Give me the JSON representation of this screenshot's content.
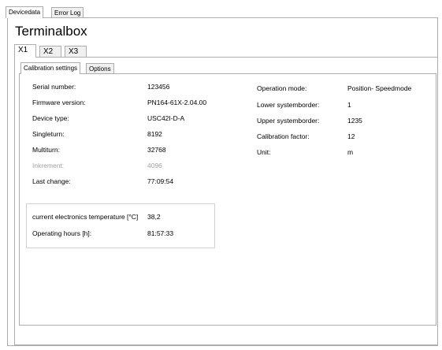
{
  "top_tabs": [
    {
      "label": "Devicedata",
      "active": true
    },
    {
      "label": "Error Log",
      "active": false
    }
  ],
  "page_title": "Terminalbox",
  "terminal_tabs": [
    {
      "label": "X1",
      "active": true
    },
    {
      "label": "X2",
      "active": false
    },
    {
      "label": "X3",
      "active": false
    }
  ],
  "config_tabs": [
    {
      "label": "Calibration settings",
      "active": true
    },
    {
      "label": "Options",
      "active": false
    }
  ],
  "left_fields": [
    {
      "label": "Serial number:",
      "value": "123456",
      "disabled": false
    },
    {
      "label": "Firmware version:",
      "value": "PN164-61X-2.04.00",
      "disabled": false
    },
    {
      "label": "Device type:",
      "value": "USC42I-D-A",
      "disabled": false
    },
    {
      "label": "Singleturn:",
      "value": "8192",
      "disabled": false
    },
    {
      "label": "Multiturn:",
      "value": "32768",
      "disabled": false
    },
    {
      "label": "Inkrement:",
      "value": "4096",
      "disabled": true
    },
    {
      "label": "Last change:",
      "value": "77:09:54",
      "disabled": false
    }
  ],
  "right_fields": [
    {
      "label": "Operation mode:",
      "value": "Position- Speedmode"
    },
    {
      "label": "Lower systemborder:",
      "value": "1"
    },
    {
      "label": "Upper systemborder:",
      "value": "1235"
    },
    {
      "label": "Calibration factor:",
      "value": "12"
    },
    {
      "label": "Unit:",
      "value": "m"
    }
  ],
  "status_group": [
    {
      "label": "current electronics temperature [°C]",
      "value": "38,2"
    },
    {
      "label": "Operating hours [h]:",
      "value": "81:57:33"
    }
  ]
}
